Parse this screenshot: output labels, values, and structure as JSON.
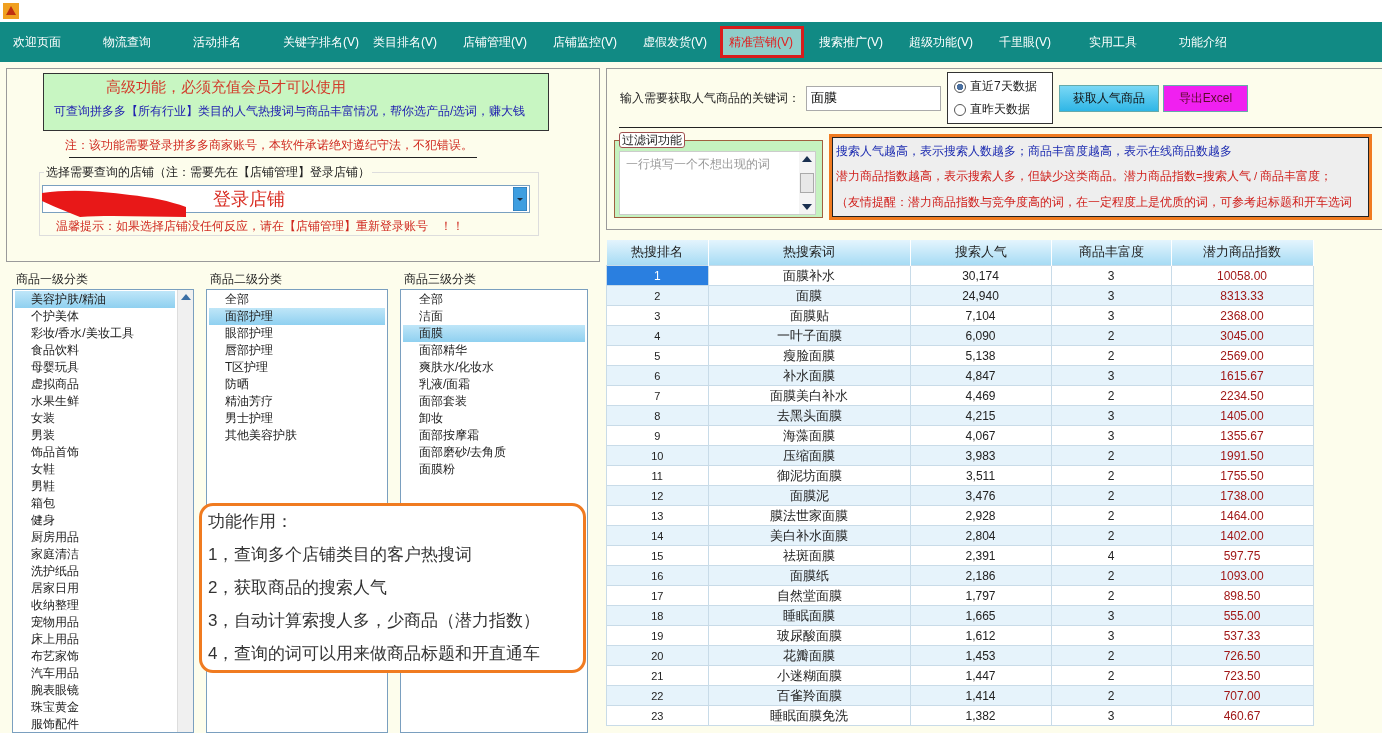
{
  "menu": [
    {
      "label": "欢迎页面",
      "selected": false
    },
    {
      "label": "物流查询",
      "selected": false
    },
    {
      "label": "活动排名",
      "selected": false
    },
    {
      "label": "关键字排名(V)",
      "selected": false
    },
    {
      "label": "类目排名(V)",
      "selected": false
    },
    {
      "label": "店铺管理(V)",
      "selected": false
    },
    {
      "label": "店铺监控(V)",
      "selected": false
    },
    {
      "label": "虚假发货(V)",
      "selected": false
    },
    {
      "label": "精准营销(V)",
      "selected": true
    },
    {
      "label": "搜索推广(V)",
      "selected": false
    },
    {
      "label": "超级功能(V)",
      "selected": false
    },
    {
      "label": "千里眼(V)",
      "selected": false
    },
    {
      "label": "实用工具",
      "selected": false
    },
    {
      "label": "功能介绍",
      "selected": false
    }
  ],
  "upgrade_notice": {
    "title": "高级功能，必须充值会员才可以使用",
    "description": "可查询拼多多【所有行业】类目的人气热搜词与商品丰富情况，帮你选产品/选词，赚大钱"
  },
  "note": "注：该功能需要登录拼多多商家账号，本软件承诺绝对遵纪守法，不犯错误。",
  "store_select": {
    "legend": "选择需要查询的店铺（注：需要先在【店铺管理】登录店铺）",
    "value": "登录店铺",
    "tip": "温馨提示：如果选择店铺没任何反应，请在【店铺管理】重新登录账号　！！"
  },
  "categories": [
    {
      "title": "商品一级分类",
      "items": [
        {
          "label": "美容护肤/精油",
          "selected": true
        },
        {
          "label": "个护美体",
          "selected": false
        },
        {
          "label": "彩妆/香水/美妆工具",
          "selected": false
        },
        {
          "label": "食品饮料",
          "selected": false
        },
        {
          "label": "母婴玩具",
          "selected": false
        },
        {
          "label": "虚拟商品",
          "selected": false
        },
        {
          "label": "水果生鲜",
          "selected": false
        },
        {
          "label": "女装",
          "selected": false
        },
        {
          "label": "男装",
          "selected": false
        },
        {
          "label": "饰品首饰",
          "selected": false
        },
        {
          "label": "女鞋",
          "selected": false
        },
        {
          "label": "男鞋",
          "selected": false
        },
        {
          "label": "箱包",
          "selected": false
        },
        {
          "label": "健身",
          "selected": false
        },
        {
          "label": "厨房用品",
          "selected": false
        },
        {
          "label": "家庭清洁",
          "selected": false
        },
        {
          "label": "洗护纸品",
          "selected": false
        },
        {
          "label": "居家日用",
          "selected": false
        },
        {
          "label": "收纳整理",
          "selected": false
        },
        {
          "label": "宠物用品",
          "selected": false
        },
        {
          "label": "床上用品",
          "selected": false
        },
        {
          "label": "布艺家饰",
          "selected": false
        },
        {
          "label": "汽车用品",
          "selected": false
        },
        {
          "label": "腕表眼镜",
          "selected": false
        },
        {
          "label": "珠宝黄金",
          "selected": false
        },
        {
          "label": "服饰配件",
          "selected": false
        }
      ]
    },
    {
      "title": "商品二级分类",
      "items": [
        {
          "label": "全部",
          "selected": false
        },
        {
          "label": "面部护理",
          "selected": true
        },
        {
          "label": "眼部护理",
          "selected": false
        },
        {
          "label": "唇部护理",
          "selected": false
        },
        {
          "label": "T区护理",
          "selected": false
        },
        {
          "label": "防晒",
          "selected": false
        },
        {
          "label": "精油芳疗",
          "selected": false
        },
        {
          "label": "男士护理",
          "selected": false
        },
        {
          "label": "其他美容护肤",
          "selected": false
        }
      ]
    },
    {
      "title": "商品三级分类",
      "items": [
        {
          "label": "全部",
          "selected": false
        },
        {
          "label": "洁面",
          "selected": false
        },
        {
          "label": "面膜",
          "selected": true
        },
        {
          "label": "面部精华",
          "selected": false
        },
        {
          "label": "爽肤水/化妆水",
          "selected": false
        },
        {
          "label": "乳液/面霜",
          "selected": false
        },
        {
          "label": "面部套装",
          "selected": false
        },
        {
          "label": "卸妆",
          "selected": false
        },
        {
          "label": "面部按摩霜",
          "selected": false
        },
        {
          "label": "面部磨砂/去角质",
          "selected": false
        },
        {
          "label": "面膜粉",
          "selected": false
        }
      ]
    }
  ],
  "feature_callout": {
    "title": "功能作用：",
    "lines": [
      "1，查询多个店铺类目的客户热搜词",
      "2，获取商品的搜索人气",
      "3，自动计算索搜人多，少商品（潜力指数）",
      "4，查询的词可以用来做商品标题和开直通车"
    ]
  },
  "keyword_search": {
    "label": "输入需要获取人气商品的关键词：",
    "value": "面膜",
    "ranges": [
      {
        "label": "直近7天数据",
        "selected": true
      },
      {
        "label": "直昨天数据",
        "selected": false
      }
    ],
    "buttons": [
      {
        "label": "获取人气商品",
        "kind": "fetch"
      },
      {
        "label": "导出Excel",
        "kind": "export"
      }
    ]
  },
  "filter": {
    "legend": "过滤词功能",
    "placeholder": "一行填写一个不想出现的词"
  },
  "hints": [
    {
      "text": "搜索人气越高，表示搜索人数越多；商品丰富度越高，表示在线商品数越多",
      "color": "#1c2bb0"
    },
    {
      "text": "潜力商品指数越高，表示搜索人多，但缺少这类商品。潜力商品指数=搜索人气 / 商品丰富度；",
      "color": "#d0201c"
    },
    {
      "text": "（友情提醒：潜力商品指数与竞争度高的词，在一定程度上是优质的词，可参考起标题和开车选词",
      "color": "#d0201c"
    }
  ],
  "table": {
    "columns": [
      "热搜排名",
      "热搜索词",
      "搜索人气",
      "商品丰富度",
      "潜力商品指数"
    ],
    "rows": [
      {
        "cells": [
          "1",
          "面膜补水",
          "30,174",
          "3",
          "10058.00"
        ],
        "selected": true
      },
      {
        "cells": [
          "2",
          "面膜",
          "24,940",
          "3",
          "8313.33"
        ],
        "selected": false
      },
      {
        "cells": [
          "3",
          "面膜贴",
          "7,104",
          "3",
          "2368.00"
        ],
        "selected": false
      },
      {
        "cells": [
          "4",
          "一叶子面膜",
          "6,090",
          "2",
          "3045.00"
        ],
        "selected": false
      },
      {
        "cells": [
          "5",
          "瘦脸面膜",
          "5,138",
          "2",
          "2569.00"
        ],
        "selected": false
      },
      {
        "cells": [
          "6",
          "补水面膜",
          "4,847",
          "3",
          "1615.67"
        ],
        "selected": false
      },
      {
        "cells": [
          "7",
          "面膜美白补水",
          "4,469",
          "2",
          "2234.50"
        ],
        "selected": false
      },
      {
        "cells": [
          "8",
          "去黑头面膜",
          "4,215",
          "3",
          "1405.00"
        ],
        "selected": false
      },
      {
        "cells": [
          "9",
          "海藻面膜",
          "4,067",
          "3",
          "1355.67"
        ],
        "selected": false
      },
      {
        "cells": [
          "10",
          "压缩面膜",
          "3,983",
          "2",
          "1991.50"
        ],
        "selected": false
      },
      {
        "cells": [
          "11",
          "御泥坊面膜",
          "3,511",
          "2",
          "1755.50"
        ],
        "selected": false
      },
      {
        "cells": [
          "12",
          "面膜泥",
          "3,476",
          "2",
          "1738.00"
        ],
        "selected": false
      },
      {
        "cells": [
          "13",
          "膜法世家面膜",
          "2,928",
          "2",
          "1464.00"
        ],
        "selected": false
      },
      {
        "cells": [
          "14",
          "美白补水面膜",
          "2,804",
          "2",
          "1402.00"
        ],
        "selected": false
      },
      {
        "cells": [
          "15",
          "祛斑面膜",
          "2,391",
          "4",
          "597.75"
        ],
        "selected": false
      },
      {
        "cells": [
          "16",
          "面膜纸",
          "2,186",
          "2",
          "1093.00"
        ],
        "selected": false
      },
      {
        "cells": [
          "17",
          "自然堂面膜",
          "1,797",
          "2",
          "898.50"
        ],
        "selected": false
      },
      {
        "cells": [
          "18",
          "睡眠面膜",
          "1,665",
          "3",
          "555.00"
        ],
        "selected": false
      },
      {
        "cells": [
          "19",
          "玻尿酸面膜",
          "1,612",
          "3",
          "537.33"
        ],
        "selected": false
      },
      {
        "cells": [
          "20",
          "花瓣面膜",
          "1,453",
          "2",
          "726.50"
        ],
        "selected": false
      },
      {
        "cells": [
          "21",
          "小迷糊面膜",
          "1,447",
          "2",
          "723.50"
        ],
        "selected": false
      },
      {
        "cells": [
          "22",
          "百雀羚面膜",
          "1,414",
          "2",
          "707.00"
        ],
        "selected": false
      },
      {
        "cells": [
          "23",
          "睡眠面膜免洗",
          "1,382",
          "3",
          "460.67"
        ],
        "selected": false
      }
    ]
  }
}
